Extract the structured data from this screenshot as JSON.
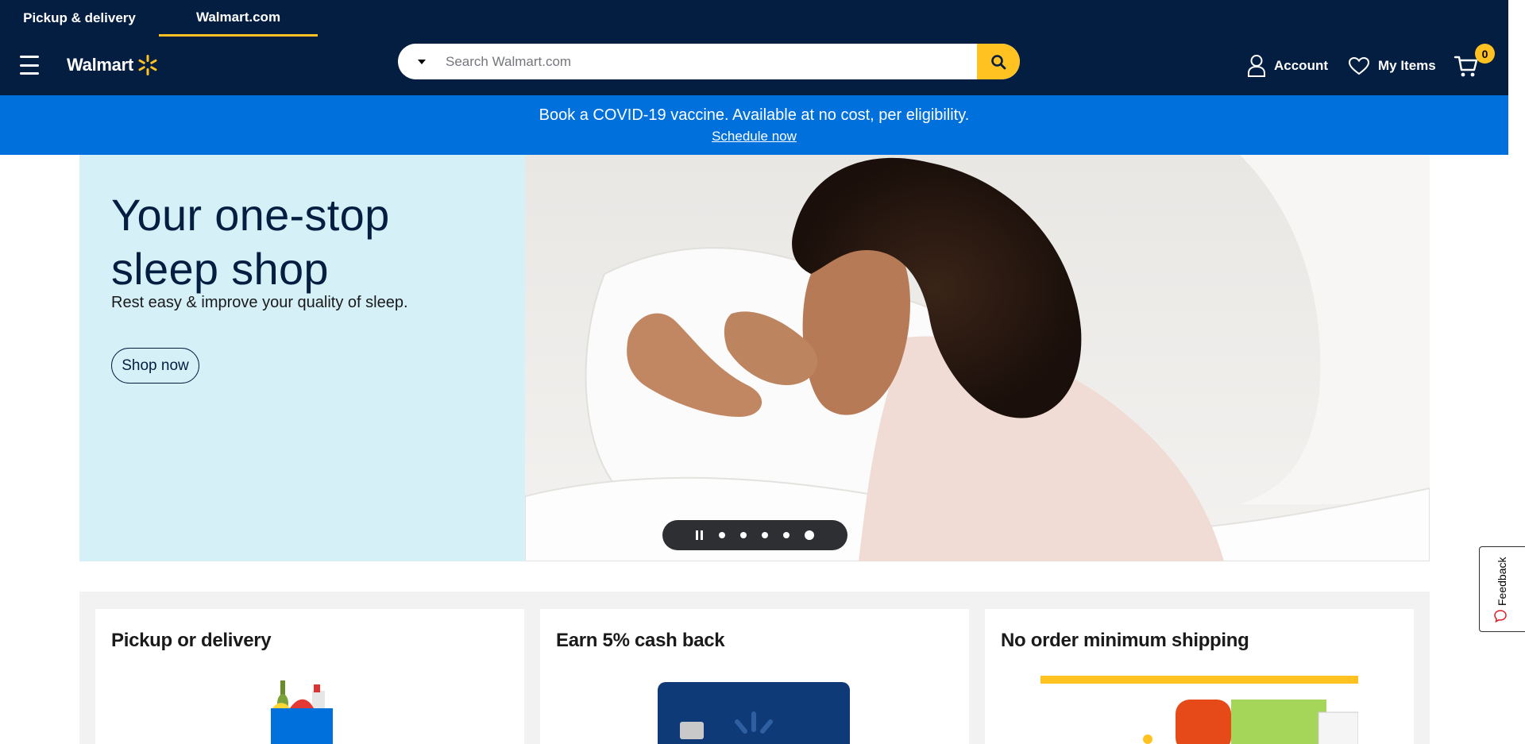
{
  "nav_tabs": [
    {
      "label": "Pickup & delivery"
    },
    {
      "label": "Walmart.com"
    }
  ],
  "logo": {
    "text": "Walmart"
  },
  "search": {
    "placeholder": "Search Walmart.com"
  },
  "header_links": {
    "account_label": "Account",
    "my_items_label": "My Items",
    "cart_count": "0"
  },
  "banner": {
    "text": "Book a COVID-19 vaccine. Available at no cost, per eligibility.",
    "link": "Schedule now"
  },
  "hero": {
    "title": "Your one-stop sleep shop",
    "subtitle": "Rest easy & improve your quality of sleep.",
    "button": "Shop now",
    "carousel": {
      "slide_count": 5,
      "active_index": 4
    }
  },
  "cards": [
    {
      "title": "Pickup or delivery"
    },
    {
      "title": "Earn 5% cash back"
    },
    {
      "title": "No order minimum shipping"
    }
  ],
  "feedback": {
    "label": "Feedback"
  },
  "colors": {
    "navy": "#041e42",
    "blue": "#0071dc",
    "yellow": "#ffc220",
    "hero_bg": "#d5f0f7"
  }
}
